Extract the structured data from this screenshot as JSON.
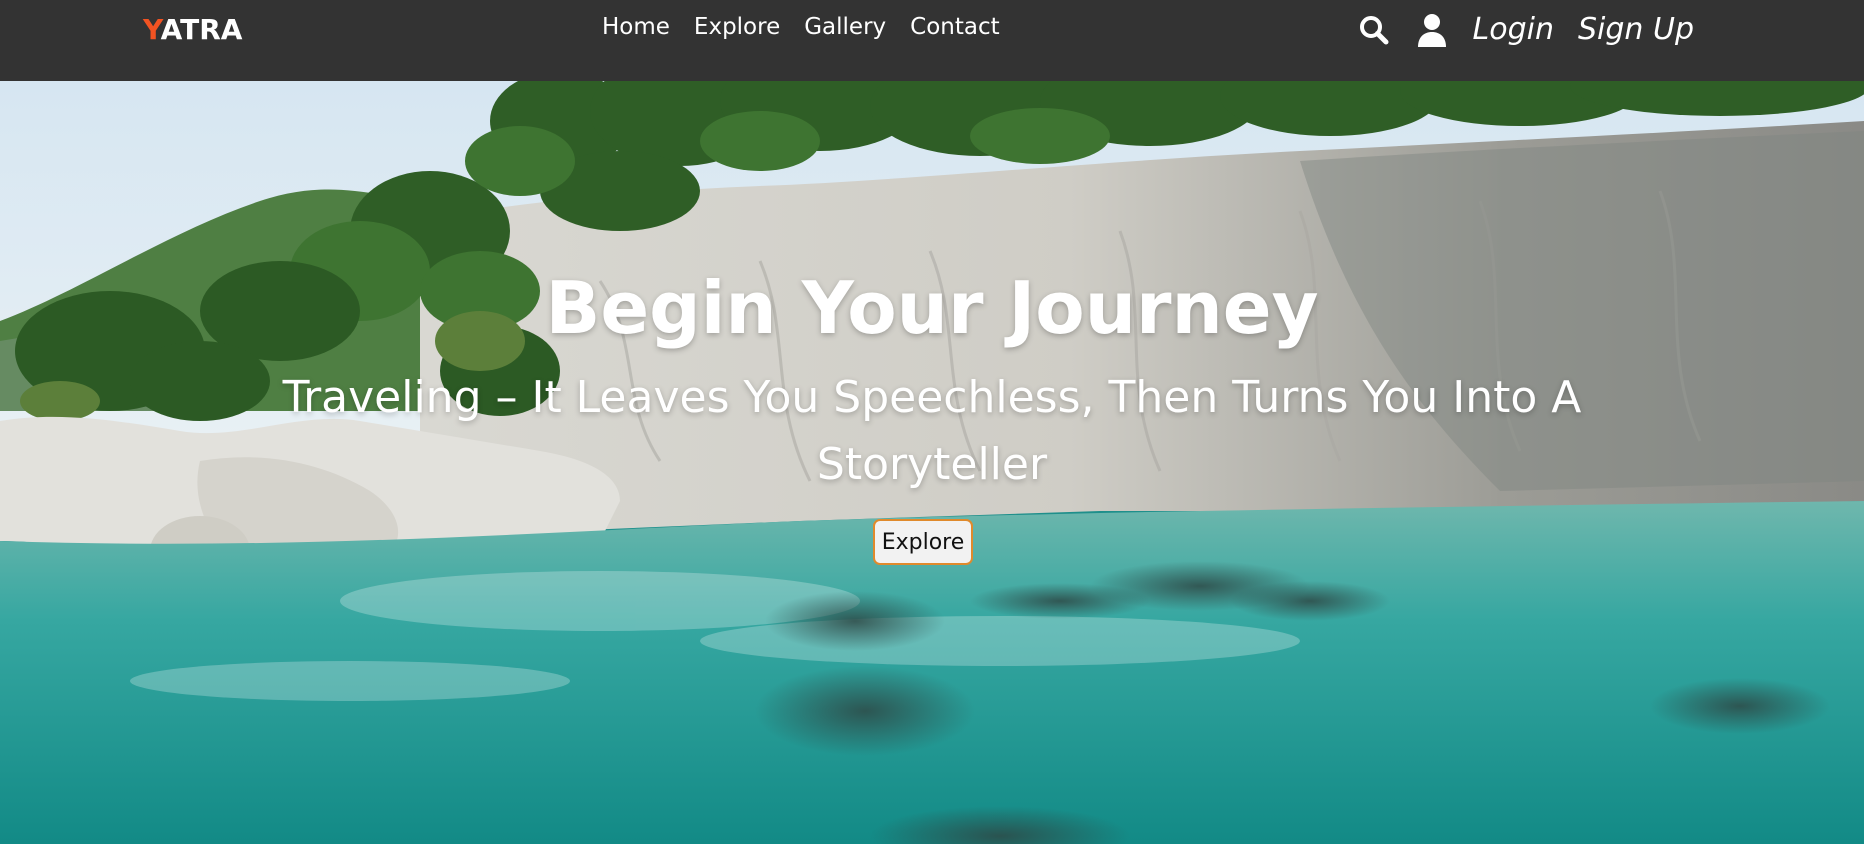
{
  "brand": {
    "first_letter": "Y",
    "rest": "ATRA",
    "accent_color": "#f25322"
  },
  "nav": {
    "links": [
      {
        "label": "Home"
      },
      {
        "label": "Explore"
      },
      {
        "label": "Gallery"
      },
      {
        "label": "Contact"
      }
    ],
    "icons": [
      "search-icon",
      "user-icon"
    ],
    "login_label": "Login",
    "signup_label": "Sign Up",
    "background_color": "#333333"
  },
  "hero": {
    "title": "Begin Your Journey",
    "subtitle": "Traveling – It Leaves You Speechless, Then Turns You Into A Storyteller",
    "button_label": "Explore",
    "button_border_color": "#e08a2c"
  }
}
